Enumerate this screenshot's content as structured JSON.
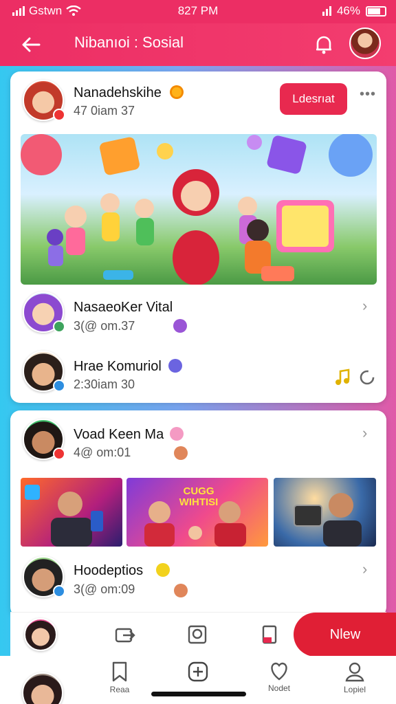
{
  "status_bar": {
    "carrier": "Gstwn",
    "time": "827 PM",
    "battery": "46%"
  },
  "app_bar": {
    "title": "Nibanıoi : Sosial"
  },
  "colors": {
    "brand": "#ec2e64",
    "accent": "#e8294f",
    "new_button": "#e01f35"
  },
  "post": {
    "author": "Nanadehskihe",
    "time": "47 0iam 37",
    "follow_label": "Ldesrıat",
    "more_label": "•••"
  },
  "comments": [
    {
      "name": "NasaeoKer Vital",
      "time": "3(@ om.37"
    },
    {
      "name": "Hrae Komuriol",
      "time": "2:30iam 30"
    }
  ],
  "post2": {
    "author": "Voad Keen Ma",
    "time": "4@ om:01",
    "thumb_caption": "CUGG WIHTISI",
    "commenter": "Hoodeptios",
    "commenter_time": "3(@ om:09"
  },
  "action_bar": {
    "new_label": "Nlew"
  },
  "nav": {
    "items": [
      {
        "label": "Reaa",
        "icon": "bookmark-icon"
      },
      {
        "label": "",
        "icon": "add-icon"
      },
      {
        "label": "Nodet",
        "icon": "heart-icon"
      },
      {
        "label": "Lopiel",
        "icon": "profile-icon"
      }
    ]
  }
}
